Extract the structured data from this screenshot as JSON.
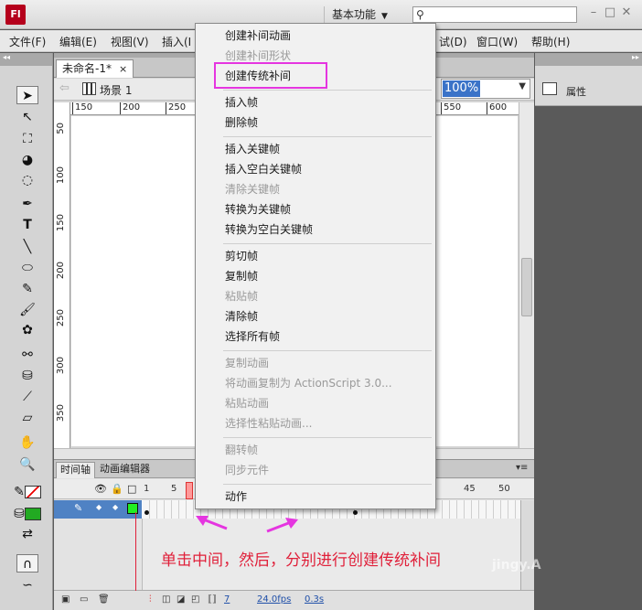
{
  "titlebar": {
    "logo": "Fl",
    "workspace_label": "基本功能",
    "workspace_arrow": "▼",
    "search_icon_glyph": "⚲",
    "win_controls": [
      "–",
      "□",
      "✕"
    ]
  },
  "menubar": {
    "items": [
      "文件(F)",
      "编辑(E)",
      "视图(V)",
      "插入(I",
      "试(D)",
      "窗口(W)",
      "帮助(H)"
    ]
  },
  "document": {
    "tab_label": "未命名-1*",
    "tab_close": "×",
    "scene_label": "场景 1",
    "zoom_value": "100%",
    "ruler_h_labels": [
      "150",
      "200",
      "250",
      "550",
      "600"
    ],
    "ruler_v_labels": [
      "50",
      "100",
      "150",
      "200",
      "250",
      "300",
      "350"
    ]
  },
  "properties": {
    "label": "属性"
  },
  "timeline": {
    "tabs": [
      "时间轴",
      "动画编辑器"
    ],
    "frame_numbers": [
      "1",
      "5",
      "45",
      "50"
    ],
    "footer": {
      "frame": "7",
      "fps": "24.0fps",
      "time": "0.3s"
    }
  },
  "context_menu": {
    "groups": [
      [
        {
          "label": "创建补间动画",
          "enabled": true
        },
        {
          "label": "创建补间形状",
          "enabled": false
        },
        {
          "label": "创建传统补间",
          "enabled": true
        }
      ],
      [
        {
          "label": "插入帧",
          "enabled": true
        },
        {
          "label": "删除帧",
          "enabled": true
        }
      ],
      [
        {
          "label": "插入关键帧",
          "enabled": true
        },
        {
          "label": "插入空白关键帧",
          "enabled": true
        },
        {
          "label": "清除关键帧",
          "enabled": false
        },
        {
          "label": "转换为关键帧",
          "enabled": true
        },
        {
          "label": "转换为空白关键帧",
          "enabled": true
        }
      ],
      [
        {
          "label": "剪切帧",
          "enabled": true
        },
        {
          "label": "复制帧",
          "enabled": true
        },
        {
          "label": "粘贴帧",
          "enabled": false
        },
        {
          "label": "清除帧",
          "enabled": true
        },
        {
          "label": "选择所有帧",
          "enabled": true
        }
      ],
      [
        {
          "label": "复制动画",
          "enabled": false
        },
        {
          "label": "将动画复制为 ActionScript 3.0...",
          "enabled": false
        },
        {
          "label": "粘贴动画",
          "enabled": false
        },
        {
          "label": "选择性粘贴动画...",
          "enabled": false
        }
      ],
      [
        {
          "label": "翻转帧",
          "enabled": false
        },
        {
          "label": "同步元件",
          "enabled": false
        }
      ],
      [
        {
          "label": "动作",
          "enabled": true
        }
      ]
    ]
  },
  "annotation": {
    "text": "单击中间，然后，分别进行创建传统补间",
    "accent_color": "#e0203a",
    "highlight_color": "#e535e0"
  },
  "watermark": "jingy.A"
}
